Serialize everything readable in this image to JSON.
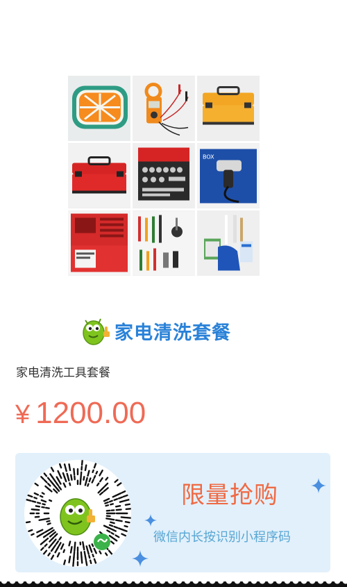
{
  "product_images": [
    {
      "name": "orange-slice-mat",
      "icon": "orange-slice"
    },
    {
      "name": "clamp-multimeter",
      "icon": "clamp-meter"
    },
    {
      "name": "yellow-toolbox",
      "icon": "toolbox-yellow"
    },
    {
      "name": "red-toolbox",
      "icon": "toolbox-red"
    },
    {
      "name": "socket-set",
      "icon": "socket-set"
    },
    {
      "name": "power-drill-box",
      "icon": "drill-box"
    },
    {
      "name": "red-drill-case",
      "icon": "drill-case"
    },
    {
      "name": "hand-tools",
      "icon": "hand-tools"
    },
    {
      "name": "cleaning-accessories",
      "icon": "cleaning-kit"
    }
  ],
  "brand": {
    "text": "家电清洗套餐",
    "logo": "mascot-thumbs-up"
  },
  "product": {
    "title": "家电清洗工具套餐",
    "currency": "¥",
    "price": "1200.00"
  },
  "promo": {
    "title": "限量抢购",
    "subtitle": "微信内长按识别小程序码",
    "qr_icon": "mini-program-code"
  },
  "colors": {
    "price": "#ef6a55",
    "brand_blue": "#2a82d8",
    "promo_bg": "#e2f0fb",
    "promo_title": "#ef6a44",
    "promo_sub": "#58a7d4"
  }
}
